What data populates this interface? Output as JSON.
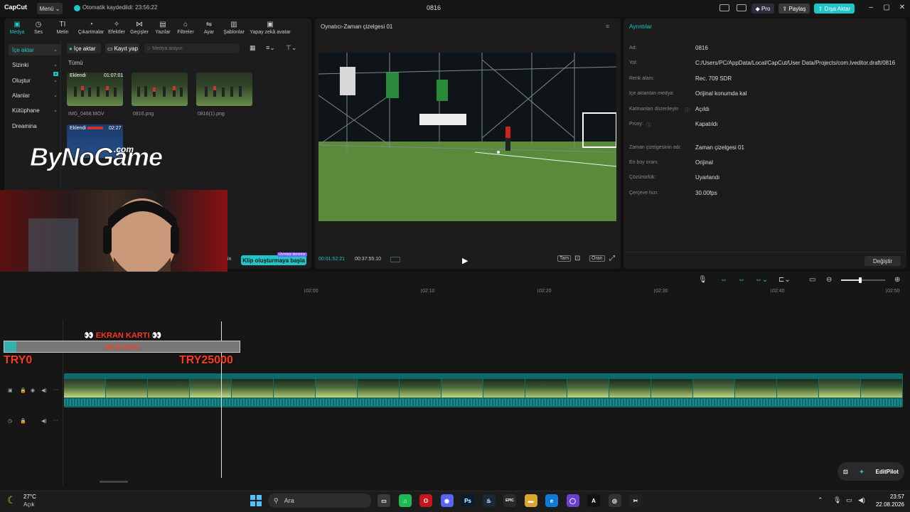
{
  "app": {
    "logo": "CapCut",
    "menu_label": "Menü",
    "autosave_text": "Otomatik kaydedildi: 23:56:22",
    "project_title": "0816",
    "pro_label": "Pro",
    "share_label": "Paylaş",
    "export_label": "Dışa Aktar"
  },
  "toolbar": {
    "tabs": [
      {
        "label": "Medya",
        "icon": "▣"
      },
      {
        "label": "Ses",
        "icon": "◷"
      },
      {
        "label": "Metin",
        "icon": "TI"
      },
      {
        "label": "Çıkartmalar",
        "icon": "◔"
      },
      {
        "label": "Efektler",
        "icon": "✧"
      },
      {
        "label": "Geçişler",
        "icon": "⋈"
      },
      {
        "label": "Yazılar",
        "icon": "▤"
      },
      {
        "label": "Filtreler",
        "icon": "⌂"
      },
      {
        "label": "Ayar",
        "icon": "⇋"
      },
      {
        "label": "Şablonlar",
        "icon": "▥"
      },
      {
        "label": "Yapay zekâ avatar",
        "icon": "▣"
      }
    ]
  },
  "sidebar": {
    "items": [
      {
        "label": "İçe aktar"
      },
      {
        "label": "Sizinki"
      },
      {
        "label": "Oluştur"
      },
      {
        "label": "Alanlar"
      },
      {
        "label": "Kütüphane"
      },
      {
        "label": "Dreamina"
      }
    ],
    "new_badge": "AI"
  },
  "media": {
    "import_label": "İçe aktar",
    "record_label": "Kayıt yap",
    "search_placeholder": "Medya arayın",
    "filter_all": "Tümü",
    "items": [
      {
        "name": "IMG_0468.MOV",
        "badge": "Eklendi",
        "duration": "01:07:01"
      },
      {
        "name": "0816.png",
        "badge": "",
        "duration": ""
      },
      {
        "name": "0816(1).png",
        "badge": "",
        "duration": ""
      },
      {
        "name": "",
        "badge": "Eklendi",
        "duration": "02:27"
      }
    ],
    "clip_button": "Klip oluşturmaya başla",
    "clip_tag": "Ücretsiz deneme",
    "partial_text": "in"
  },
  "overlay": {
    "watermark": "ByNoGame",
    "watermark_suffix": ".com",
    "card_title": "EKRAN KARTI",
    "progress_text": "5% (0.22%)",
    "progress_value": 0.05,
    "min_label": "TRY0",
    "max_label": "TRY25000"
  },
  "player": {
    "title": "Oynatıcı-Zaman çizelgesi 01",
    "timecode_current": "00:01:52:21",
    "timecode_total": "00:37:55:10",
    "btn_full": "Tam",
    "btn_ratio": "Oran"
  },
  "details": {
    "title": "Ayrıntılar",
    "rows": [
      {
        "label": "Ad:",
        "value": "0816"
      },
      {
        "label": "Yol:",
        "value": "C:/Users/PC/AppData/Local/CapCut/User Data/Projects/com.lveditor.draft/0816"
      },
      {
        "label": "Renk alanı:",
        "value": "Rec. 709 SDR"
      },
      {
        "label": "İçe aktarılan medya:",
        "value": "Orijinal konumda kal"
      },
      {
        "label": "Katmanları düzenleyin",
        "value": "Açıldı"
      },
      {
        "label": "Proxy:",
        "value": "Kapatıldı"
      },
      {
        "label": "Zaman çizelgesinin adı:",
        "value": "Zaman çizelgesi 01"
      },
      {
        "label": "En boy oranı:",
        "value": "Orijinal"
      },
      {
        "label": "Çözünürlük:",
        "value": "Uyarlandı"
      },
      {
        "label": "Çerçeve hızı:",
        "value": "30.00fps"
      }
    ],
    "change_button": "Değiştir"
  },
  "timeline": {
    "ruler": [
      "02:00",
      "02:10",
      "02:20",
      "02:30",
      "02:40",
      "02:50"
    ]
  },
  "editpilot": "EditPilot",
  "taskbar": {
    "temperature": "27°C",
    "condition": "Açık",
    "search_placeholder": "Ara",
    "time": "23:57",
    "date": "22.08.2026",
    "apps": [
      {
        "name": "file-explorer",
        "glyph": "▭",
        "color": "#3a3a3a"
      },
      {
        "name": "spotify",
        "glyph": "♫",
        "color": "#1db954"
      },
      {
        "name": "opera",
        "glyph": "O",
        "color": "#c4161c"
      },
      {
        "name": "discord",
        "glyph": "◉",
        "color": "#5865f2"
      },
      {
        "name": "photoshop",
        "glyph": "Ps",
        "color": "#001e36"
      },
      {
        "name": "steam",
        "glyph": "♨",
        "color": "#1b2838"
      },
      {
        "name": "epic-games",
        "glyph": "EPIC",
        "color": "#2a2a2a"
      },
      {
        "name": "folder",
        "glyph": "▬",
        "color": "#d9a62e"
      },
      {
        "name": "edge",
        "glyph": "e",
        "color": "#0c7ad7"
      },
      {
        "name": "app-circle",
        "glyph": "◯",
        "color": "#6b3fd1"
      },
      {
        "name": "app-a",
        "glyph": "A",
        "color": "#111"
      },
      {
        "name": "obs",
        "glyph": "◎",
        "color": "#333"
      },
      {
        "name": "capcut",
        "glyph": "✂",
        "color": "#222"
      }
    ]
  }
}
